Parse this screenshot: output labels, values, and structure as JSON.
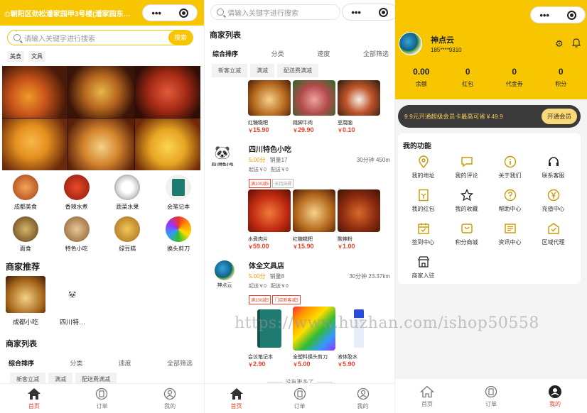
{
  "screen1": {
    "location": "◎朝阳区劲松潘家园甲3号楼(潘家园东…",
    "search_placeholder": "请输入关键字进行搜索",
    "search_button": "搜索",
    "hot_tags": [
      "美食",
      "文具"
    ],
    "categories": [
      "成都美食",
      "香辣水煮",
      "蔬菜水果",
      "会笔记本",
      "面食",
      "特色小吃",
      "绿豆糕",
      "换头剪刀"
    ],
    "recommend_title": "商家推荐",
    "recommend": [
      "成都小吃",
      "四川特…"
    ],
    "list_title": "商家列表",
    "sort": [
      "综合排序",
      "分类",
      "速度",
      "全部筛选"
    ],
    "chips": [
      "新客立减",
      "满减",
      "配送费满减"
    ]
  },
  "screen2": {
    "search_placeholder": "请输入关键字进行搜索",
    "list_title": "商家列表",
    "sort": [
      "综合排序",
      "分类",
      "速度",
      "全部筛选"
    ],
    "chips": [
      "新客立减",
      "满减",
      "配送费满减"
    ],
    "shops": [
      {
        "logo_text": "四川特色小吃",
        "name": "四川特色小吃",
        "rating": "5.00分",
        "sales": "销量17",
        "delivery": "30分钟 450m",
        "start": "起送￥0",
        "fee": "配送￥0",
        "tags": [
          "满100减5",
          "支持自提"
        ],
        "products": [
          {
            "name": "红糖糍粑",
            "price": "15.90"
          },
          {
            "name": "跳脚牛肉",
            "price": "29.90"
          },
          {
            "name": "豆腐脑",
            "price": "0.10"
          }
        ]
      },
      {
        "logo_text": "神点云",
        "name": "体全文具店",
        "rating": "5.00分",
        "sales": "销量8",
        "delivery": "30分钟 23.37km",
        "start": "起送￥0",
        "fee": "配送￥0",
        "tags": [
          "满100减5",
          "门店新客减5"
        ],
        "products": [
          {
            "name": "水煮肉片",
            "price": "59.00"
          },
          {
            "name": "红糖糍粑",
            "price": "15.90"
          },
          {
            "name": "酸辣粉",
            "price": "1.00"
          }
        ]
      }
    ],
    "stationery": [
      {
        "name": "会议笔记本",
        "price": "2.90"
      },
      {
        "name": "全塑料换头剪刀",
        "price": "5.00"
      },
      {
        "name": "液体胶水",
        "price": "5.90"
      }
    ],
    "no_more": "没有更多了",
    "currency": "￥"
  },
  "screen3": {
    "username": "神点云",
    "phone": "185****9310",
    "stats": [
      {
        "value": "0.00",
        "label": "余额"
      },
      {
        "value": "0",
        "label": "红包"
      },
      {
        "value": "0",
        "label": "代金券"
      },
      {
        "value": "0",
        "label": "积分"
      }
    ],
    "vip_text": "9.9元开通超级会员卡最高可省￥49.9",
    "vip_button": "开通会员",
    "func_title": "我的功能",
    "funcs": [
      "我的地址",
      "我的评论",
      "关于我们",
      "联系客服",
      "我的红包",
      "我的收藏",
      "帮助中心",
      "充值中心",
      "签到中心",
      "积分商城",
      "资讯中心",
      "区域代理",
      "商家入驻"
    ],
    "logo_text": "神点云"
  },
  "tabs": [
    "首页",
    "订单",
    "我的"
  ],
  "watermark": "https://www.huzhan.com/ishop50558",
  "colors": {
    "accent": "#f7c600",
    "price": "#e8412c",
    "dark": "#333"
  }
}
